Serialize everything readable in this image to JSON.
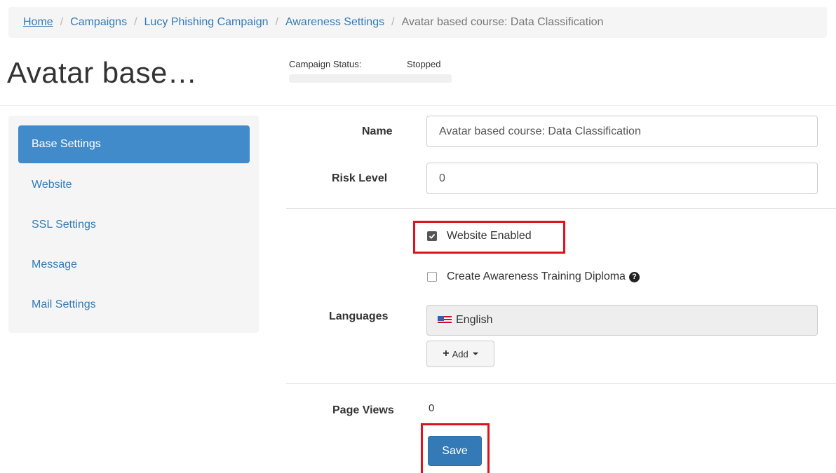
{
  "breadcrumb": {
    "items": [
      "Home",
      "Campaigns",
      "Lucy Phishing Campaign",
      "Awareness Settings"
    ],
    "active": "Avatar based course: Data Classification",
    "separator": "/"
  },
  "page_title": "Avatar base…",
  "campaign_status": {
    "label": "Campaign Status:",
    "value": "Stopped"
  },
  "sidebar": {
    "items": [
      {
        "label": "Base Settings",
        "active": true
      },
      {
        "label": "Website"
      },
      {
        "label": "SSL Settings"
      },
      {
        "label": "Message"
      },
      {
        "label": "Mail Settings"
      }
    ]
  },
  "form": {
    "name_label": "Name",
    "name_value": "Avatar based course: Data Classification",
    "risk_label": "Risk Level",
    "risk_value": "0",
    "website_enabled_label": "Website Enabled",
    "website_enabled_checked": true,
    "diploma_label": "Create Awareness Training Diploma",
    "diploma_checked": false,
    "help_icon": "question-circle-icon",
    "languages_label": "Languages",
    "language_value": "English",
    "flag_icon": "us-flag-icon",
    "add_label": "Add",
    "page_views_label": "Page Views",
    "page_views_value": "0",
    "save_label": "Save"
  },
  "colors": {
    "link": "#337ab7",
    "active_nav": "#428bca",
    "primary_button": "#337ab7",
    "highlight_box": "#e0111b"
  }
}
